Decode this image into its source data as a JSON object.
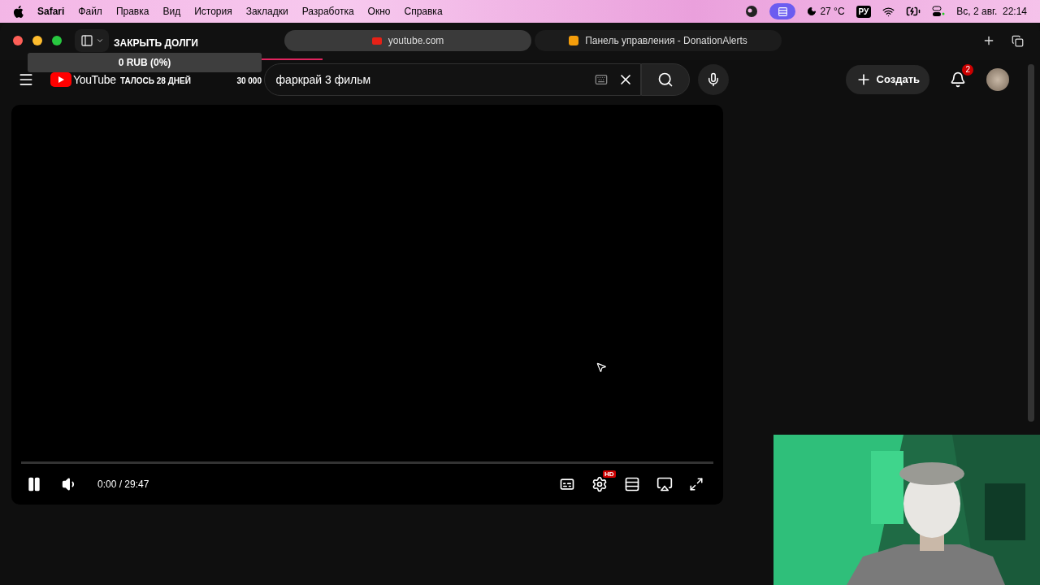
{
  "menu_bar": {
    "app": "Safari",
    "items": [
      "Файл",
      "Правка",
      "Вид",
      "История",
      "Закладки",
      "Разработка",
      "Окно",
      "Справка"
    ],
    "temperature": "27 °C",
    "input_language": "РУ",
    "clock": "Вс, 2 авг.  22:14"
  },
  "browser": {
    "tabs": [
      {
        "label": "youtube.com",
        "selected": true
      },
      {
        "label": "Панель управления - DonationAlerts",
        "selected": false
      }
    ],
    "page_load": {
      "level": 0.31
    }
  },
  "donation_widget": {
    "title": "ЗАКРЫТЬ ДОЛГИ",
    "amount": "0 RUB (0%)",
    "days_left": "ТАЛОСЬ 28 ДНЕЙ",
    "goal": "30 000",
    "level": 0
  },
  "youtube": {
    "logo": "YouTube",
    "search": {
      "value": "фаркрай 3 фильм"
    },
    "create_button": "Создать",
    "notifications": "2",
    "player": {
      "playing": true,
      "time": "0:00 / 29:47",
      "level": 0,
      "quality_badge": "HD"
    }
  }
}
